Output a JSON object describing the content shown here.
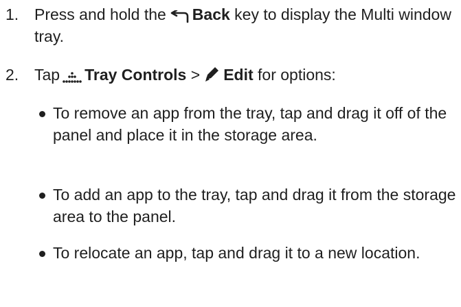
{
  "steps": [
    {
      "number": "1.",
      "text_before": "Press and hold the",
      "icon": "back-arrow-icon",
      "bold": "Back",
      "text_after": "key to display the Multi window tray."
    },
    {
      "number": "2.",
      "text_before": "Tap",
      "icon1": "tray-controls-dots-icon",
      "bold1": "Tray Controls",
      "separator": ">",
      "icon2": "edit-pencil-icon",
      "bold2": "Edit",
      "text_after": "for options:"
    }
  ],
  "bullets": [
    "To remove an app from the tray, tap and drag it off of the panel and place it in the storage area.",
    "To add an app to the tray, tap and drag it from the storage area to the panel.",
    "To relocate an app, tap and drag it to a new location."
  ],
  "colors": {
    "text": "#1f1f1f",
    "background": "#ffffff"
  }
}
